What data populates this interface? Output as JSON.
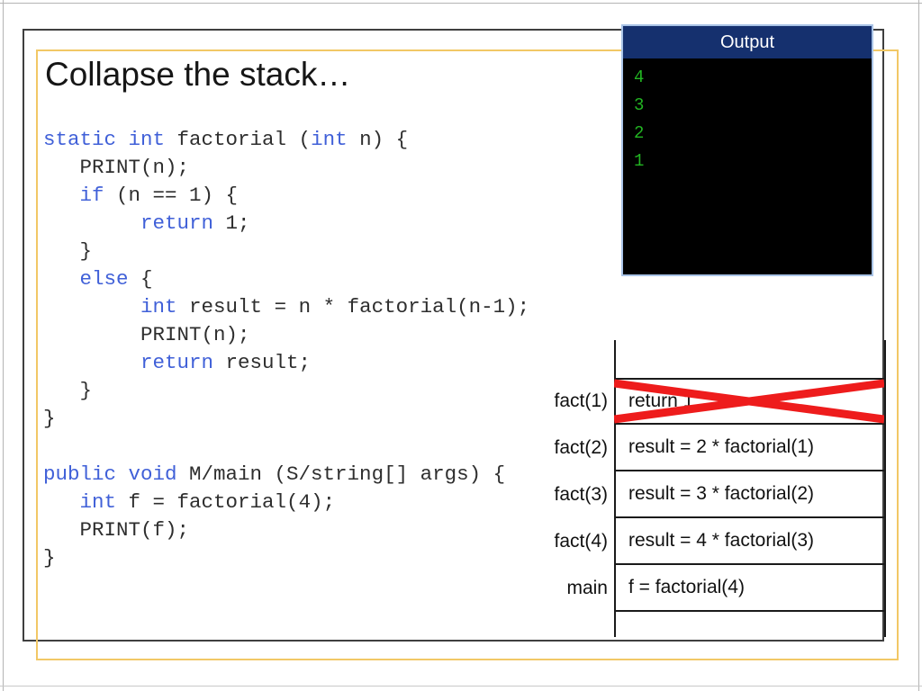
{
  "slide": {
    "title": "Collapse the stack…"
  },
  "code": {
    "lines": [
      [
        {
          "t": "static ",
          "c": "kw"
        },
        {
          "t": "int ",
          "c": "kw"
        },
        {
          "t": "factorial ("
        },
        {
          "t": "int",
          "c": "kw"
        },
        {
          "t": " n) {"
        }
      ],
      [
        {
          "t": "   PRINT(n);"
        }
      ],
      [
        {
          "t": "   "
        },
        {
          "t": "if",
          "c": "kw"
        },
        {
          "t": " (n == 1) {"
        }
      ],
      [
        {
          "t": "        "
        },
        {
          "t": "return",
          "c": "kw"
        },
        {
          "t": " 1;"
        }
      ],
      [
        {
          "t": "   }"
        }
      ],
      [
        {
          "t": "   "
        },
        {
          "t": "else",
          "c": "kw"
        },
        {
          "t": " {"
        }
      ],
      [
        {
          "t": "        "
        },
        {
          "t": "int",
          "c": "kw"
        },
        {
          "t": " result = n * factorial(n-1);"
        }
      ],
      [
        {
          "t": "        PRINT(n);"
        }
      ],
      [
        {
          "t": "        "
        },
        {
          "t": "return",
          "c": "kw"
        },
        {
          "t": " result;"
        }
      ],
      [
        {
          "t": "   }"
        }
      ],
      [
        {
          "t": "}"
        }
      ],
      [
        {
          "t": " "
        }
      ],
      [
        {
          "t": "public ",
          "c": "kw"
        },
        {
          "t": "void ",
          "c": "kw"
        },
        {
          "t": "M/main (S/string[] args) {"
        }
      ],
      [
        {
          "t": "   "
        },
        {
          "t": "int",
          "c": "kw"
        },
        {
          "t": " f = factorial(4);"
        }
      ],
      [
        {
          "t": "   PRINT(f);"
        }
      ],
      [
        {
          "t": "}"
        }
      ]
    ]
  },
  "output_window": {
    "title": "Output",
    "lines": [
      "4",
      "3",
      "2",
      "1"
    ],
    "title_bg": "#15306e",
    "body_bg": "#000000",
    "text_color": "#22b422"
  },
  "stack": {
    "rows": [
      {
        "label": "fact(1)",
        "text": "return 1",
        "crossed_out": true
      },
      {
        "label": "fact(2)",
        "text": "result = 2 * factorial(1)",
        "crossed_out": false
      },
      {
        "label": "fact(3)",
        "text": "result = 3 * factorial(2)",
        "crossed_out": false
      },
      {
        "label": "fact(4)",
        "text": "result = 4 * factorial(3)",
        "crossed_out": false
      },
      {
        "label": "main",
        "text": "f = factorial(4)",
        "crossed_out": false
      }
    ],
    "cross_color": "#ee1c1c"
  },
  "colors": {
    "keyword_blue": "#4060D8",
    "frame_dark": "#3f3f3f",
    "frame_gold": "#f2c866"
  }
}
